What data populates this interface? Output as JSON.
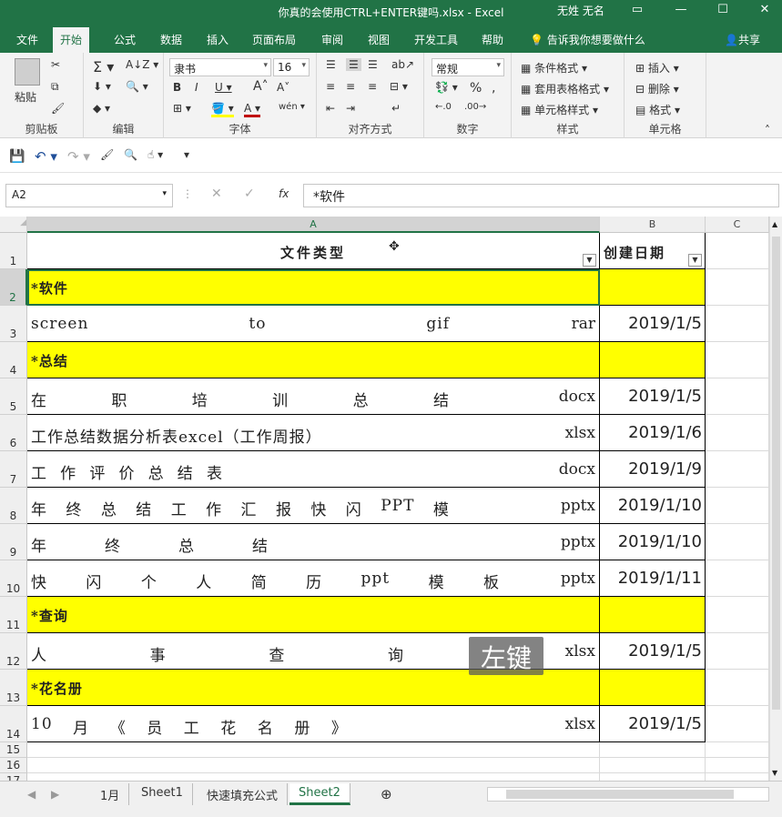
{
  "window": {
    "title": "你真的会使用CTRL+ENTER键吗.xlsx  -  Excel",
    "user": "无姓 无名",
    "controls": [
      "ribbon-display",
      "minimize",
      "maximize",
      "close"
    ]
  },
  "menu": {
    "tabs": [
      "文件",
      "开始",
      "公式",
      "数据",
      "插入",
      "页面布局",
      "审阅",
      "视图",
      "开发工具",
      "帮助"
    ],
    "active": "开始",
    "tell_me": "告诉我你想要做什么",
    "share": "共享"
  },
  "ribbon": {
    "clipboard": {
      "label": "剪贴板",
      "paste": "粘贴"
    },
    "editing": {
      "label": "编辑"
    },
    "font": {
      "label": "字体",
      "name": "隶书",
      "size": "16"
    },
    "alignment": {
      "label": "对齐方式"
    },
    "number": {
      "label": "数字",
      "format": "常规",
      "percent": "%",
      "comma": ","
    },
    "styles": {
      "label": "样式",
      "conditional": "条件格式",
      "table": "套用表格格式",
      "cell": "单元格样式"
    },
    "cells": {
      "label": "单元格",
      "insert": "插入",
      "delete": "删除",
      "format": "格式"
    }
  },
  "formula_bar": {
    "name_box": "A2",
    "fx": "fx",
    "content": "*软件"
  },
  "columns": [
    "A",
    "B",
    "C"
  ],
  "rows": [
    {
      "n": "1",
      "type": "header",
      "a": "文件类型",
      "b": "创建日期"
    },
    {
      "n": "2",
      "type": "category",
      "a": "*软件"
    },
    {
      "n": "3",
      "type": "item",
      "a_parts": [
        "screen",
        "to",
        "gif"
      ],
      "ext": "rar",
      "b": "2019/1/5"
    },
    {
      "n": "4",
      "type": "category",
      "a": "*总结"
    },
    {
      "n": "5",
      "type": "item",
      "a_parts": [
        "在",
        "职",
        "培",
        "训",
        "总",
        "结"
      ],
      "ext": "docx",
      "b": "2019/1/5"
    },
    {
      "n": "6",
      "type": "item",
      "a_parts": [
        "工作总结数据分析表excel（工作周报）"
      ],
      "ext": "xlsx",
      "b": "2019/1/6"
    },
    {
      "n": "7",
      "type": "item",
      "a_parts": [
        "工",
        "作",
        "评",
        "价",
        "总",
        "结",
        "表"
      ],
      "ext": "docx",
      "b": "2019/1/9",
      "span": 0.34
    },
    {
      "n": "8",
      "type": "item",
      "a_parts": [
        "年",
        "终",
        "总",
        "结",
        "工",
        "作",
        "汇",
        "报",
        "快",
        "闪",
        "PPT",
        "模"
      ],
      "ext": "pptx",
      "b": "2019/1/10"
    },
    {
      "n": "9",
      "type": "item",
      "a_parts": [
        "年",
        "终",
        "总",
        "结"
      ],
      "ext": "pptx",
      "b": "2019/1/10",
      "span": 0.42
    },
    {
      "n": "10",
      "type": "item",
      "a_parts": [
        "快",
        "闪",
        "个",
        "人",
        "简",
        "历",
        "ppt",
        "模",
        "板"
      ],
      "ext": "pptx",
      "b": "2019/1/11",
      "span": 0.83
    },
    {
      "n": "11",
      "type": "category",
      "a": "*查询"
    },
    {
      "n": "12",
      "type": "item",
      "a_parts": [
        "人",
        "事",
        "查",
        "询"
      ],
      "ext": "xlsx",
      "b": "2019/1/5",
      "span": 0.66
    },
    {
      "n": "13",
      "type": "category",
      "a": "*花名册"
    },
    {
      "n": "14",
      "type": "item",
      "a_parts": [
        "10",
        "月",
        "《",
        "员",
        "工",
        "花",
        "名",
        "册",
        "》"
      ],
      "ext": "xlsx",
      "b": "2019/1/5",
      "span": 0.56
    },
    {
      "n": "15",
      "type": "empty"
    },
    {
      "n": "16",
      "type": "empty"
    },
    {
      "n": "17",
      "type": "empty"
    }
  ],
  "sheets": [
    "1月",
    "Sheet1",
    "快速填充公式",
    "Sheet2"
  ],
  "active_sheet": "Sheet2",
  "overlay": "左键",
  "colors": {
    "excel_green": "#217346",
    "highlight": "#ffff00"
  }
}
